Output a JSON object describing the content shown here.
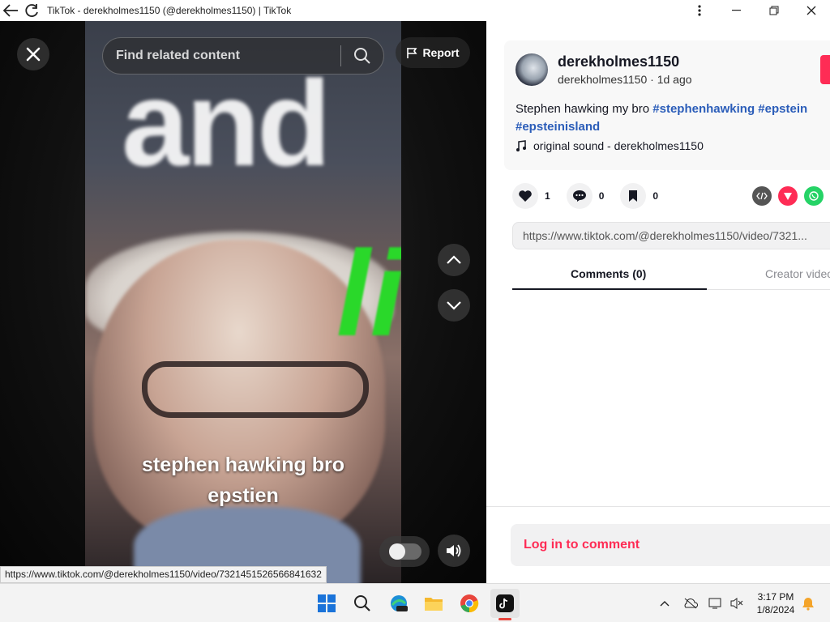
{
  "window": {
    "title": "TikTok - derekholmes1150 (@derekholmes1150) | TikTok",
    "icons": [
      "back-arrow-icon",
      "reload-icon",
      "more-vertical-icon",
      "minimize-icon",
      "maximize-icon",
      "close-window-icon"
    ]
  },
  "player": {
    "search_placeholder": "Find related content",
    "report_label": "Report",
    "video_overlay_text": "and",
    "green_overlay_text": "li",
    "caption_line1": "stephen hawking bro",
    "caption_line2": "epstien",
    "hover_url": "https://www.tiktok.com/@derekholmes1150/video/7321451526566841632"
  },
  "post": {
    "username": "derekholmes1150",
    "subline": "derekholmes1150 · 1d ago",
    "description_text": "Stephen hawking my bro ",
    "hashtags": [
      "#stephenhawking",
      "#epstein",
      "#epsteinisland"
    ],
    "sound": "original sound - derekholmes1150",
    "likes": "1",
    "comments": "0",
    "saves": "0",
    "share_colors": {
      "embed": "#555555",
      "send": "#fe2c55",
      "whatsapp": "#25d366"
    },
    "link": "https://www.tiktok.com/@derekholmes1150/video/7321..."
  },
  "tabs": {
    "comments": "Comments (0)",
    "creator": "Creator videos"
  },
  "login_prompt": "Log in to comment",
  "taskbar": {
    "apps": [
      "windows-start-icon",
      "search-icon",
      "edge-preview-icon",
      "file-explorer-icon",
      "chrome-icon",
      "tiktok-icon"
    ],
    "time": "3:17 PM",
    "date": "1/8/2024"
  }
}
